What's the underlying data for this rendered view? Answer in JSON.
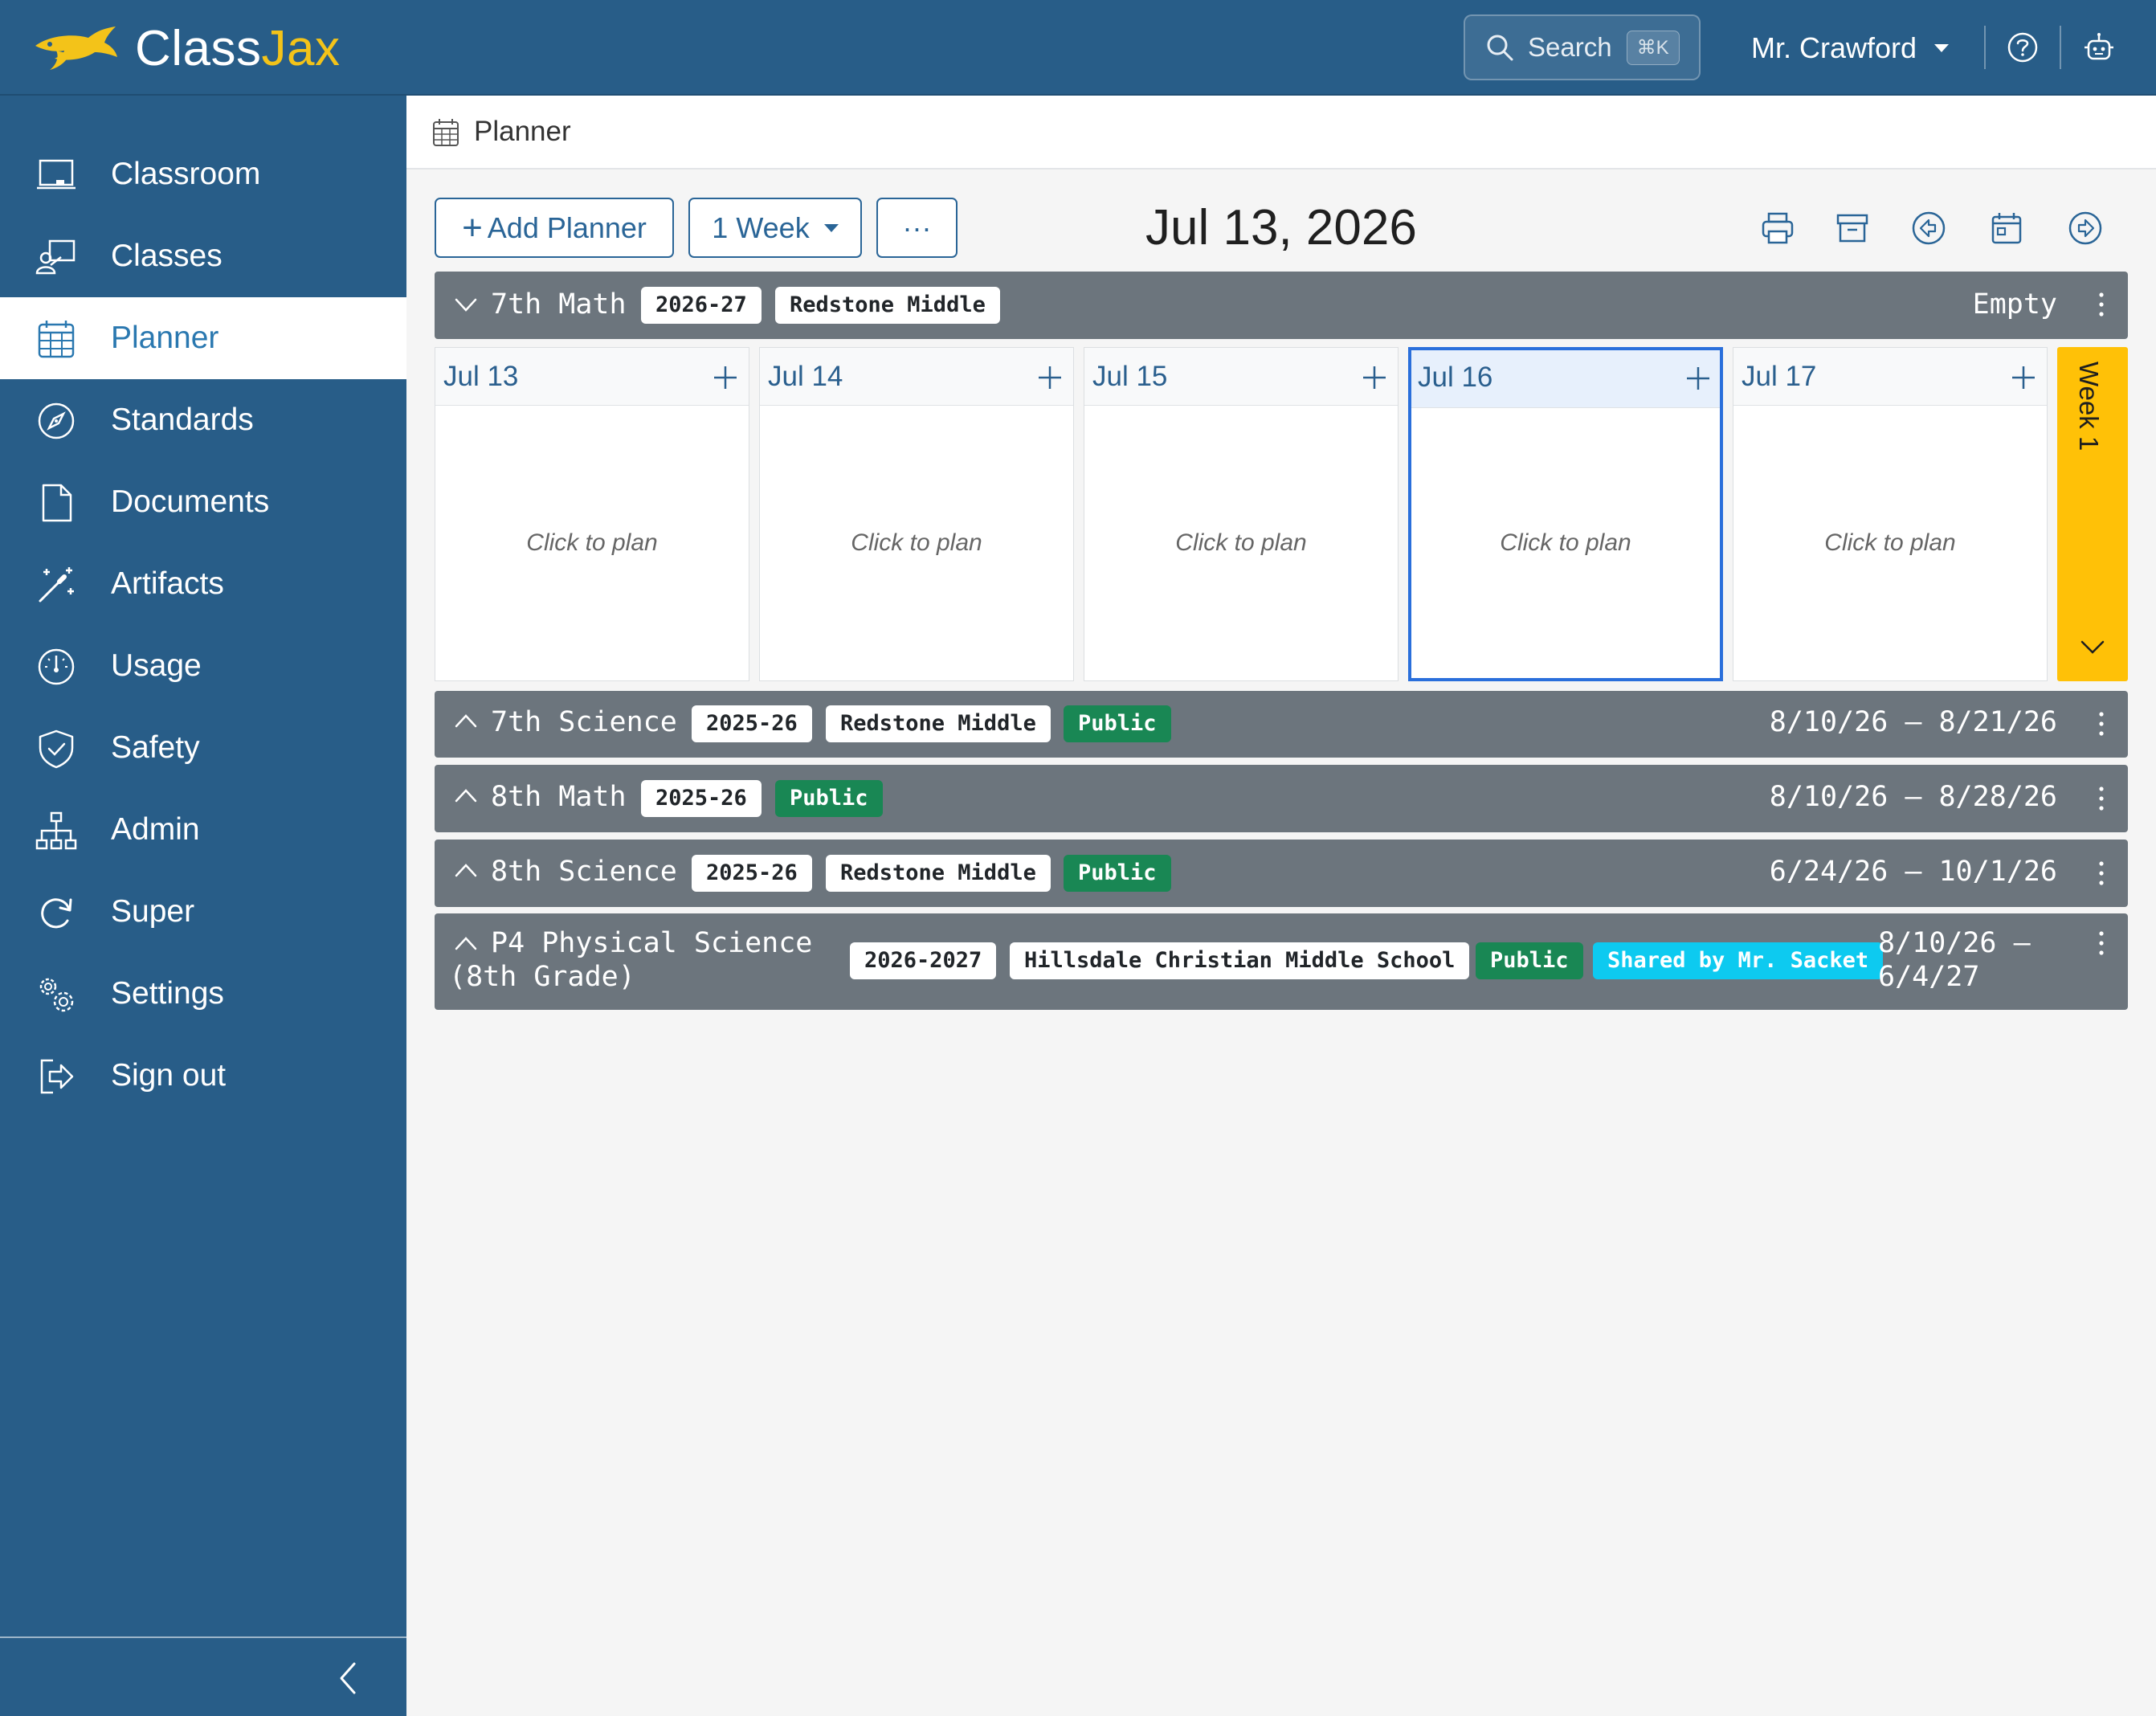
{
  "app": {
    "logo_part1": "Class",
    "logo_part2": "Jax",
    "search_label": "Search",
    "search_shortcut": "⌘K",
    "user_name": "Mr. Crawford",
    "help_icon": "question-circle-icon",
    "assistant_icon": "robot-icon"
  },
  "sidebar": {
    "items": [
      {
        "label": "Classroom",
        "icon": "chalkboard-icon"
      },
      {
        "label": "Classes",
        "icon": "teacher-icon"
      },
      {
        "label": "Planner",
        "icon": "calendar-grid-icon",
        "active": true
      },
      {
        "label": "Standards",
        "icon": "compass-icon"
      },
      {
        "label": "Documents",
        "icon": "document-icon"
      },
      {
        "label": "Artifacts",
        "icon": "magic-wand-icon"
      },
      {
        "label": "Usage",
        "icon": "speedometer-icon"
      },
      {
        "label": "Safety",
        "icon": "shield-check-icon"
      },
      {
        "label": "Admin",
        "icon": "org-chart-icon"
      },
      {
        "label": "Super",
        "icon": "refresh-circle-icon"
      },
      {
        "label": "Settings",
        "icon": "gears-icon"
      },
      {
        "label": "Sign out",
        "icon": "sign-out-icon"
      }
    ],
    "collapse_icon": "chevron-left-icon"
  },
  "breadcrumb": {
    "label": "Planner"
  },
  "toolbar": {
    "add_planner_label": "Add Planner",
    "view_label": "1 Week",
    "more_label": "···",
    "current_date": "Jul 13, 2026",
    "icons": [
      "printer-icon",
      "archive-icon",
      "arrow-left-circle-icon",
      "calendar-icon",
      "arrow-right-circle-icon"
    ]
  },
  "planners": [
    {
      "title": "7th Math",
      "expanded": true,
      "badges": [
        {
          "text": "2026-27",
          "style": "light"
        },
        {
          "text": "Redstone Middle",
          "style": "light"
        }
      ],
      "status": "Empty",
      "days": [
        {
          "label": "Jul 13",
          "body": "Click to plan",
          "selected": false
        },
        {
          "label": "Jul 14",
          "body": "Click to plan",
          "selected": false
        },
        {
          "label": "Jul 15",
          "body": "Click to plan",
          "selected": false
        },
        {
          "label": "Jul 16",
          "body": "Click to plan",
          "selected": true
        },
        {
          "label": "Jul 17",
          "body": "Click to plan",
          "selected": false
        }
      ],
      "week_label": "Week 1"
    },
    {
      "title": "7th Science",
      "badges": [
        {
          "text": "2025-26",
          "style": "light"
        },
        {
          "text": "Redstone Middle",
          "style": "light"
        },
        {
          "text": "Public",
          "style": "green"
        }
      ],
      "date_range": "8/10/26 – 8/21/26"
    },
    {
      "title": "8th Math",
      "badges": [
        {
          "text": "2025-26",
          "style": "light"
        },
        {
          "text": "Public",
          "style": "green"
        }
      ],
      "date_range": "8/10/26 – 8/28/26"
    },
    {
      "title": "8th Science",
      "badges": [
        {
          "text": "2025-26",
          "style": "light"
        },
        {
          "text": "Redstone Middle",
          "style": "light"
        },
        {
          "text": "Public",
          "style": "green"
        }
      ],
      "date_range": "6/24/26 – 10/1/26"
    },
    {
      "title": "P4 Physical Science\n(8th Grade)",
      "badges": [
        {
          "text": "2026-2027",
          "style": "light"
        },
        {
          "text": "Hillsdale Christian Middle School",
          "style": "light"
        },
        {
          "text": "Public",
          "style": "green"
        },
        {
          "text": "Shared by Mr. Sacket",
          "style": "cyan"
        }
      ],
      "date_range": "8/10/26 –\n6/4/27"
    }
  ],
  "colors": {
    "brand_blue": "#285d88",
    "logo_yellow": "#f3c319",
    "row_gray": "#6c757d",
    "public_green": "#198754",
    "shared_cyan": "#0dcaf0",
    "week_yellow": "#ffc107",
    "selected_blue": "#2a6fdb"
  }
}
